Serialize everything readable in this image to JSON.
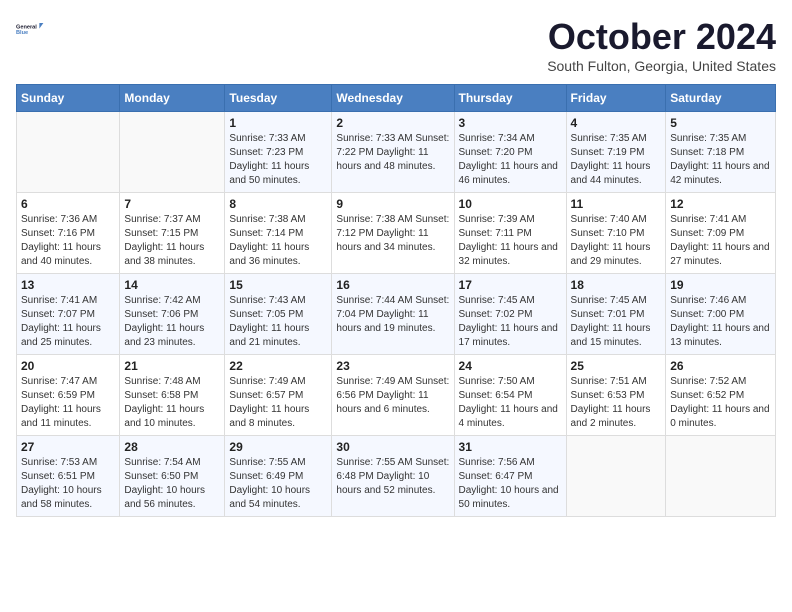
{
  "logo": {
    "line1": "General",
    "line2": "Blue"
  },
  "title": "October 2024",
  "subtitle": "South Fulton, Georgia, United States",
  "headers": [
    "Sunday",
    "Monday",
    "Tuesday",
    "Wednesday",
    "Thursday",
    "Friday",
    "Saturday"
  ],
  "weeks": [
    [
      {
        "day": "",
        "info": ""
      },
      {
        "day": "",
        "info": ""
      },
      {
        "day": "1",
        "info": "Sunrise: 7:33 AM\nSunset: 7:23 PM\nDaylight: 11 hours and 50 minutes."
      },
      {
        "day": "2",
        "info": "Sunrise: 7:33 AM\nSunset: 7:22 PM\nDaylight: 11 hours and 48 minutes."
      },
      {
        "day": "3",
        "info": "Sunrise: 7:34 AM\nSunset: 7:20 PM\nDaylight: 11 hours and 46 minutes."
      },
      {
        "day": "4",
        "info": "Sunrise: 7:35 AM\nSunset: 7:19 PM\nDaylight: 11 hours and 44 minutes."
      },
      {
        "day": "5",
        "info": "Sunrise: 7:35 AM\nSunset: 7:18 PM\nDaylight: 11 hours and 42 minutes."
      }
    ],
    [
      {
        "day": "6",
        "info": "Sunrise: 7:36 AM\nSunset: 7:16 PM\nDaylight: 11 hours and 40 minutes."
      },
      {
        "day": "7",
        "info": "Sunrise: 7:37 AM\nSunset: 7:15 PM\nDaylight: 11 hours and 38 minutes."
      },
      {
        "day": "8",
        "info": "Sunrise: 7:38 AM\nSunset: 7:14 PM\nDaylight: 11 hours and 36 minutes."
      },
      {
        "day": "9",
        "info": "Sunrise: 7:38 AM\nSunset: 7:12 PM\nDaylight: 11 hours and 34 minutes."
      },
      {
        "day": "10",
        "info": "Sunrise: 7:39 AM\nSunset: 7:11 PM\nDaylight: 11 hours and 32 minutes."
      },
      {
        "day": "11",
        "info": "Sunrise: 7:40 AM\nSunset: 7:10 PM\nDaylight: 11 hours and 29 minutes."
      },
      {
        "day": "12",
        "info": "Sunrise: 7:41 AM\nSunset: 7:09 PM\nDaylight: 11 hours and 27 minutes."
      }
    ],
    [
      {
        "day": "13",
        "info": "Sunrise: 7:41 AM\nSunset: 7:07 PM\nDaylight: 11 hours and 25 minutes."
      },
      {
        "day": "14",
        "info": "Sunrise: 7:42 AM\nSunset: 7:06 PM\nDaylight: 11 hours and 23 minutes."
      },
      {
        "day": "15",
        "info": "Sunrise: 7:43 AM\nSunset: 7:05 PM\nDaylight: 11 hours and 21 minutes."
      },
      {
        "day": "16",
        "info": "Sunrise: 7:44 AM\nSunset: 7:04 PM\nDaylight: 11 hours and 19 minutes."
      },
      {
        "day": "17",
        "info": "Sunrise: 7:45 AM\nSunset: 7:02 PM\nDaylight: 11 hours and 17 minutes."
      },
      {
        "day": "18",
        "info": "Sunrise: 7:45 AM\nSunset: 7:01 PM\nDaylight: 11 hours and 15 minutes."
      },
      {
        "day": "19",
        "info": "Sunrise: 7:46 AM\nSunset: 7:00 PM\nDaylight: 11 hours and 13 minutes."
      }
    ],
    [
      {
        "day": "20",
        "info": "Sunrise: 7:47 AM\nSunset: 6:59 PM\nDaylight: 11 hours and 11 minutes."
      },
      {
        "day": "21",
        "info": "Sunrise: 7:48 AM\nSunset: 6:58 PM\nDaylight: 11 hours and 10 minutes."
      },
      {
        "day": "22",
        "info": "Sunrise: 7:49 AM\nSunset: 6:57 PM\nDaylight: 11 hours and 8 minutes."
      },
      {
        "day": "23",
        "info": "Sunrise: 7:49 AM\nSunset: 6:56 PM\nDaylight: 11 hours and 6 minutes."
      },
      {
        "day": "24",
        "info": "Sunrise: 7:50 AM\nSunset: 6:54 PM\nDaylight: 11 hours and 4 minutes."
      },
      {
        "day": "25",
        "info": "Sunrise: 7:51 AM\nSunset: 6:53 PM\nDaylight: 11 hours and 2 minutes."
      },
      {
        "day": "26",
        "info": "Sunrise: 7:52 AM\nSunset: 6:52 PM\nDaylight: 11 hours and 0 minutes."
      }
    ],
    [
      {
        "day": "27",
        "info": "Sunrise: 7:53 AM\nSunset: 6:51 PM\nDaylight: 10 hours and 58 minutes."
      },
      {
        "day": "28",
        "info": "Sunrise: 7:54 AM\nSunset: 6:50 PM\nDaylight: 10 hours and 56 minutes."
      },
      {
        "day": "29",
        "info": "Sunrise: 7:55 AM\nSunset: 6:49 PM\nDaylight: 10 hours and 54 minutes."
      },
      {
        "day": "30",
        "info": "Sunrise: 7:55 AM\nSunset: 6:48 PM\nDaylight: 10 hours and 52 minutes."
      },
      {
        "day": "31",
        "info": "Sunrise: 7:56 AM\nSunset: 6:47 PM\nDaylight: 10 hours and 50 minutes."
      },
      {
        "day": "",
        "info": ""
      },
      {
        "day": "",
        "info": ""
      }
    ]
  ]
}
